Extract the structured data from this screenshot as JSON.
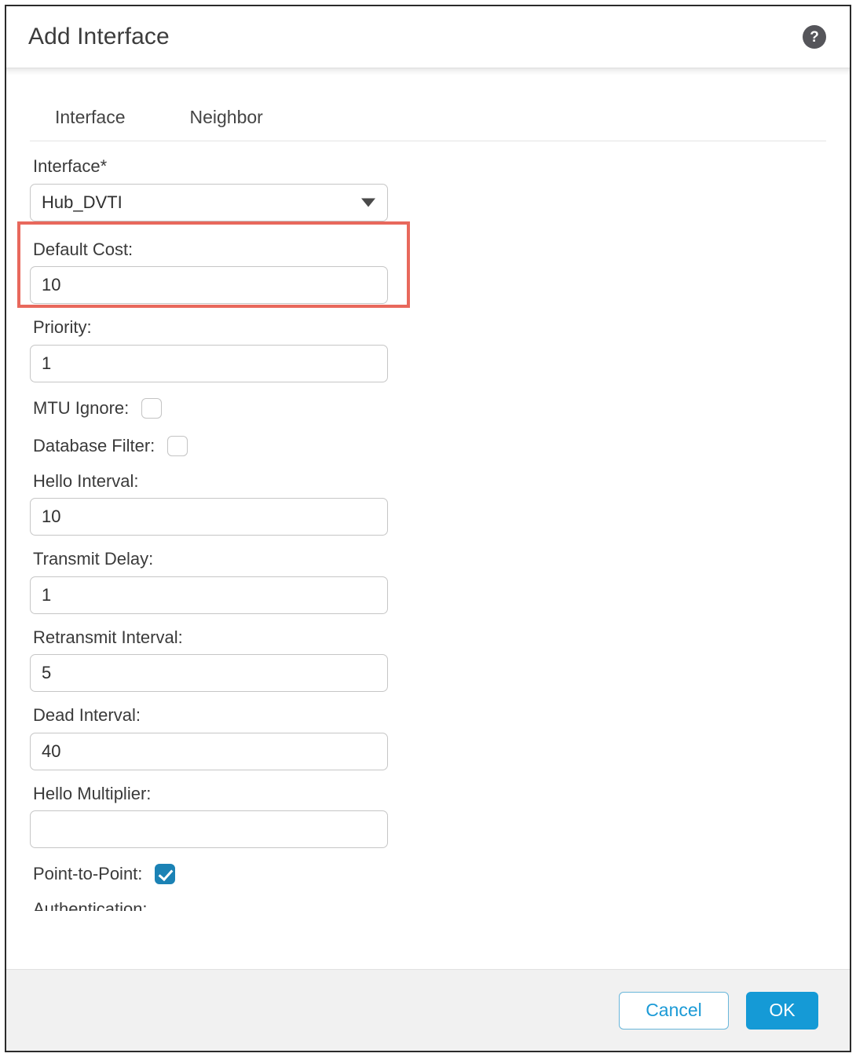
{
  "dialog": {
    "title": "Add Interface",
    "help_icon_label": "?"
  },
  "tabs": [
    {
      "label": "Interface",
      "selected": true
    },
    {
      "label": "Neighbor",
      "selected": false
    }
  ],
  "form": {
    "interface": {
      "label": "Interface*",
      "value": "Hub_DVTI",
      "caret_icon": "chevron-down-icon"
    },
    "default_cost": {
      "label": "Default Cost:",
      "value": "10"
    },
    "priority": {
      "label": "Priority:",
      "value": "1"
    },
    "mtu_ignore": {
      "label": "MTU Ignore:",
      "checked": false
    },
    "database_filter": {
      "label": "Database Filter:",
      "checked": false
    },
    "hello_interval": {
      "label": "Hello Interval:",
      "value": "10"
    },
    "transmit_delay": {
      "label": "Transmit Delay:",
      "value": "1"
    },
    "retransmit_interval": {
      "label": "Retransmit Interval:",
      "value": "5"
    },
    "dead_interval": {
      "label": "Dead Interval:",
      "value": "40"
    },
    "hello_multiplier": {
      "label": "Hello Multiplier:",
      "value": ""
    },
    "point_to_point": {
      "label": "Point-to-Point:",
      "checked": true
    },
    "next_partial_label": "Authentication:"
  },
  "footer": {
    "cancel_label": "Cancel",
    "ok_label": "OK"
  },
  "annotations": {
    "color": "#e8685c",
    "highlighted_fields": [
      "Interface*",
      "Point-to-Point:"
    ]
  },
  "colors": {
    "accent_blue": "#159ad6",
    "checkbox_blue": "#1b82b5",
    "annotation_red": "#e8685c",
    "footer_gray": "#f1f1f1",
    "help_icon_gray": "#55555a"
  }
}
